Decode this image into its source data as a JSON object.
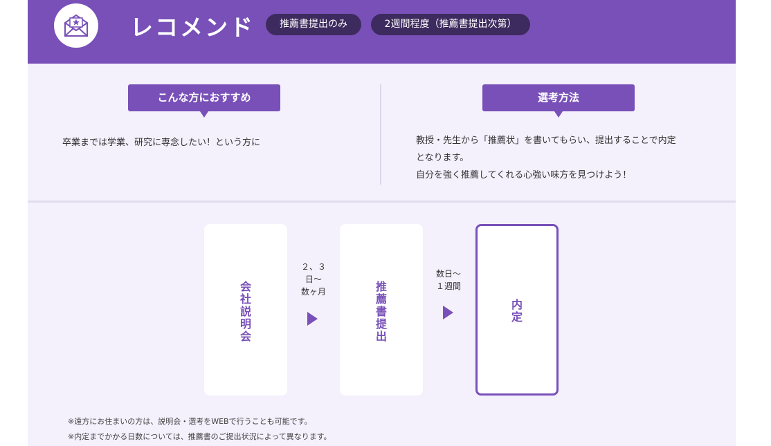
{
  "header": {
    "title": "レコメンド",
    "badges": [
      "推薦書提出のみ",
      "2週間程度（推薦書提出次第）"
    ],
    "icon": "envelope-star-icon",
    "colors": {
      "primary": "#7850b8",
      "badge_bg": "#3d2a5e",
      "background": "#f4f0fc"
    }
  },
  "recommend": {
    "label": "こんな方におすすめ",
    "text": "卒業までは学業、研究に専念したい！という方に"
  },
  "selection": {
    "label": "選考方法",
    "lines": [
      "教授・先生から「推薦状」を書いてもらい、提出することで内定",
      "となります。",
      "自分を強く推薦してくれる心強い味方を見つけよう！"
    ]
  },
  "flow": {
    "cards": [
      "会社説明会",
      "推薦書提出",
      "内定"
    ],
    "steps": [
      {
        "lines": [
          "２、３",
          "日～",
          "数ヶ月"
        ]
      },
      {
        "lines": [
          "数日～",
          "１週間"
        ]
      }
    ]
  },
  "notes": [
    "※遠方にお住まいの方は、説明会・選考をWEBで行うことも可能です。",
    "※内定までかかる日数については、推薦書のご提出状況によって異なります。"
  ]
}
